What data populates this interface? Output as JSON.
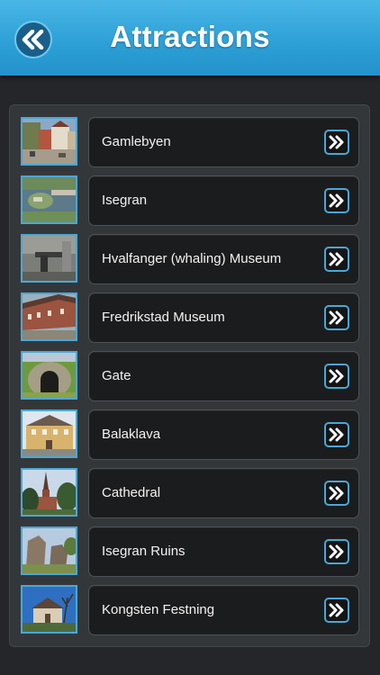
{
  "header": {
    "title": "Attractions",
    "back_icon": "double-chevron-left-icon"
  },
  "items": [
    {
      "label": "Gamlebyen",
      "thumb": "town-square-photo"
    },
    {
      "label": "Isegran",
      "thumb": "aerial-island-photo"
    },
    {
      "label": "Hvalfanger (whaling) Museum",
      "thumb": "whaling-cannon-photo"
    },
    {
      "label": "Fredrikstad Museum",
      "thumb": "museum-street-photo"
    },
    {
      "label": "Gate",
      "thumb": "tunnel-gate-photo"
    },
    {
      "label": "Balaklava",
      "thumb": "yellow-building-photo"
    },
    {
      "label": "Cathedral",
      "thumb": "cathedral-photo"
    },
    {
      "label": "Isegran Ruins",
      "thumb": "stone-ruins-photo"
    },
    {
      "label": "Kongsten Festning",
      "thumb": "fortress-photo"
    }
  ],
  "colors": {
    "header": "#2c9fd6",
    "accent": "#4aa8d6",
    "background": "#242629"
  }
}
